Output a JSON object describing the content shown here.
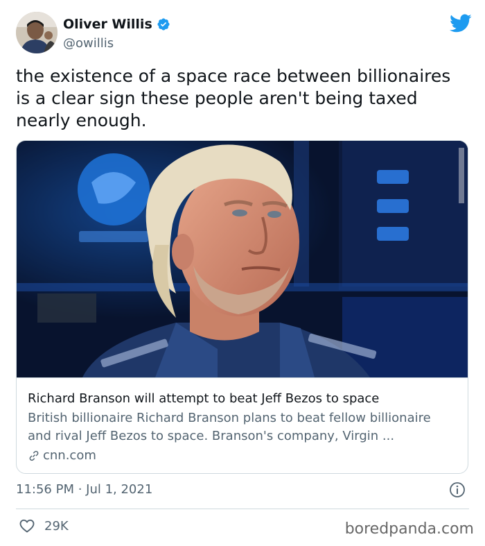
{
  "tweet": {
    "author_name": "Oliver Willis",
    "author_handle": "@owillis",
    "text": "the existence of a space race between billionaires is a clear sign these people aren't being taxed nearly enough.",
    "timestamp": "11:56 PM · Jul 1, 2021",
    "likes": "29K"
  },
  "card": {
    "title": "Richard Branson will attempt to beat Jeff Bezos to space",
    "description": "British billionaire Richard Branson plans to beat fellow billionaire and rival Jeff Bezos to space. Branson's company, Virgin ...",
    "source": "cnn.com"
  },
  "watermark": "boredpanda.com",
  "icons": {
    "verified": "verified-badge-icon",
    "platform": "twitter-bird-icon",
    "link": "link-icon",
    "info": "info-icon",
    "like": "heart-icon"
  },
  "colors": {
    "brand": "#1d9bf0",
    "text_primary": "#0f1419",
    "text_secondary": "#536471",
    "border": "#cfd9de"
  }
}
